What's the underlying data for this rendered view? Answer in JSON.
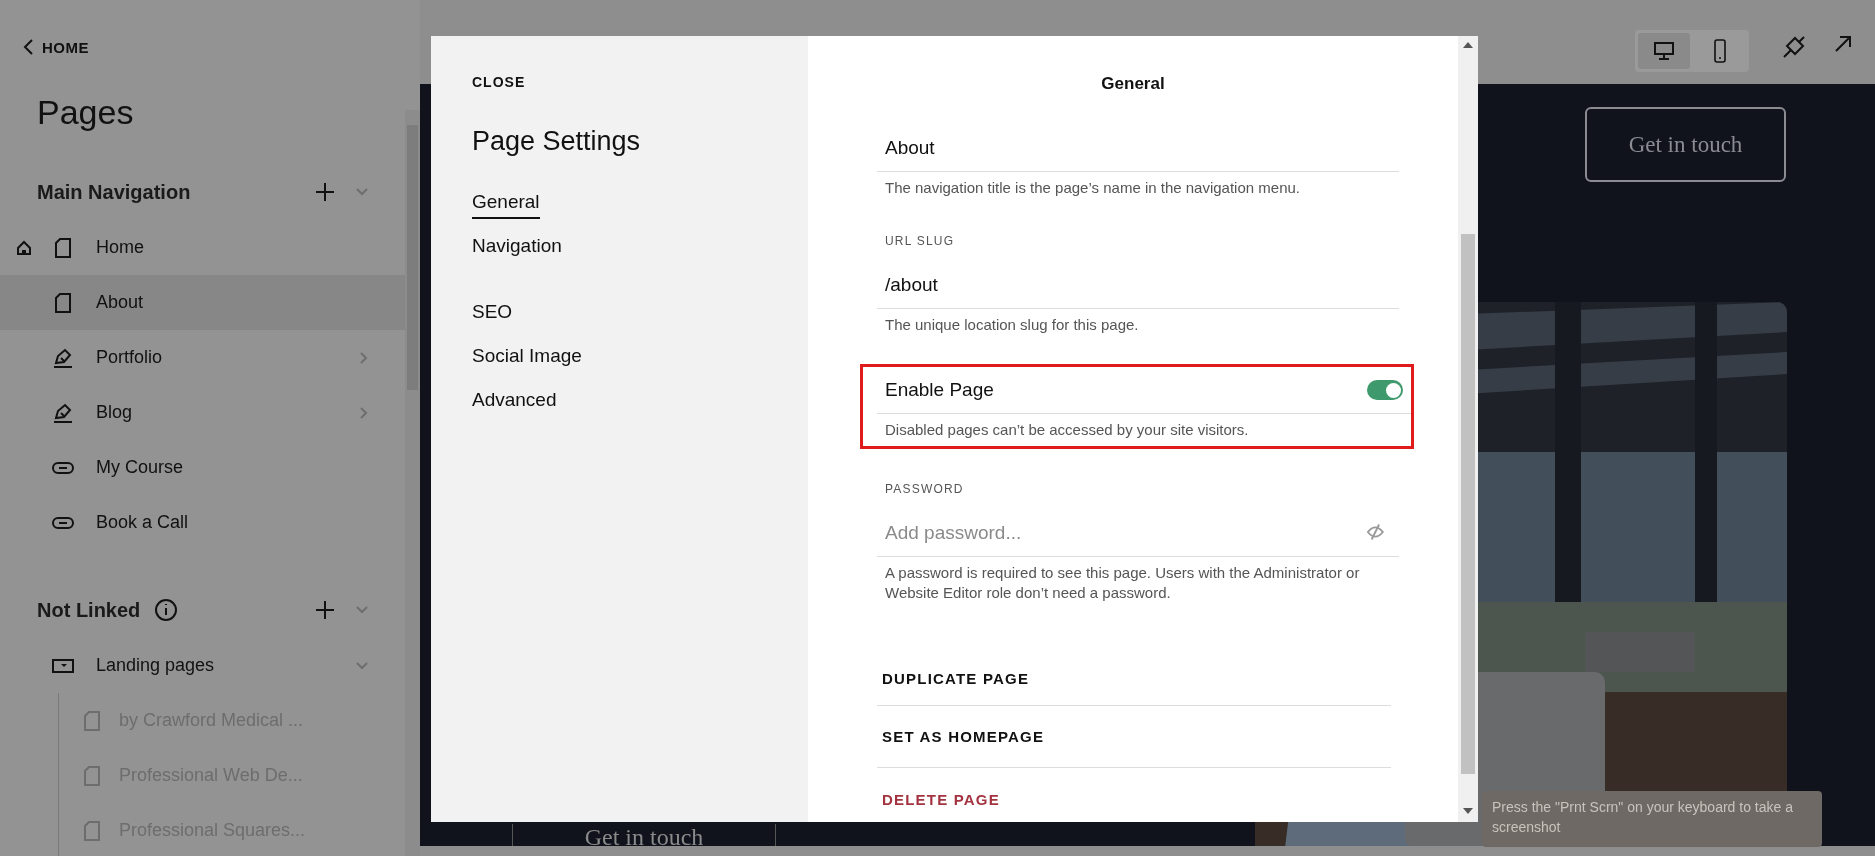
{
  "sidebar": {
    "back_link": "HOME",
    "title": "Pages",
    "sections": [
      {
        "title": "Main Navigation",
        "info": false,
        "expanded": true,
        "items": [
          {
            "label": "Home",
            "kind": "page",
            "homepage": true,
            "selected": false,
            "has_chevron": false
          },
          {
            "label": "About",
            "kind": "page",
            "homepage": false,
            "selected": true,
            "has_chevron": false
          },
          {
            "label": "Portfolio",
            "kind": "collection",
            "homepage": false,
            "selected": false,
            "has_chevron": true
          },
          {
            "label": "Blog",
            "kind": "collection",
            "homepage": false,
            "selected": false,
            "has_chevron": true
          },
          {
            "label": "My Course",
            "kind": "link",
            "homepage": false,
            "selected": false,
            "has_chevron": false
          },
          {
            "label": "Book a Call",
            "kind": "link",
            "homepage": false,
            "selected": false,
            "has_chevron": false
          }
        ]
      },
      {
        "title": "Not Linked",
        "info": true,
        "expanded": true,
        "items": [
          {
            "label": "Landing pages",
            "kind": "folder",
            "homepage": false,
            "selected": false,
            "has_chevron": false,
            "expanded": true,
            "children": [
              {
                "label": "by Crawford Medical ...",
                "kind": "page",
                "disabled": true
              },
              {
                "label": "Professional Web De...",
                "kind": "page",
                "disabled": true
              },
              {
                "label": "Professional Squares...",
                "kind": "page",
                "disabled": true
              }
            ]
          }
        ]
      }
    ]
  },
  "topbar": {
    "devices": [
      {
        "kind": "desktop",
        "selected": true
      },
      {
        "kind": "mobile",
        "selected": false
      }
    ]
  },
  "preview": {
    "header_button": "Get in touch",
    "footer_button": "Get in touch"
  },
  "modal": {
    "close": "CLOSE",
    "title": "Page Settings",
    "nav_groups": [
      {
        "items": [
          {
            "label": "General",
            "selected": true
          },
          {
            "label": "Navigation",
            "selected": false
          }
        ]
      },
      {
        "items": [
          {
            "label": "SEO",
            "selected": false
          },
          {
            "label": "Social Image",
            "selected": false
          },
          {
            "label": "Advanced",
            "selected": false
          }
        ]
      }
    ],
    "panel_title": "General",
    "fields": [
      {
        "kind": "text",
        "value": "About",
        "help": "The navigation title is the page’s name in the navigation menu."
      },
      {
        "kind": "text",
        "label": "URL SLUG",
        "value": "/about",
        "help": "The unique location slug for this page."
      },
      {
        "kind": "toggle",
        "label": "Enable Page",
        "on": true,
        "highlighted": true,
        "help": "Disabled pages can’t be accessed by your site visitors."
      },
      {
        "kind": "password",
        "label": "PASSWORD",
        "placeholder": "Add password...",
        "help": "A password is required to see this page. Users with the Administrator or Website Editor role don’t need a password."
      }
    ],
    "actions": [
      {
        "label": "DUPLICATE PAGE",
        "danger": false
      },
      {
        "label": "SET AS HOMEPAGE",
        "danger": false
      },
      {
        "label": "DELETE PAGE",
        "danger": true
      }
    ]
  },
  "toast": {
    "text": "Press the \"Prnt Scrn\" on your keyboard to take a screenshot"
  }
}
